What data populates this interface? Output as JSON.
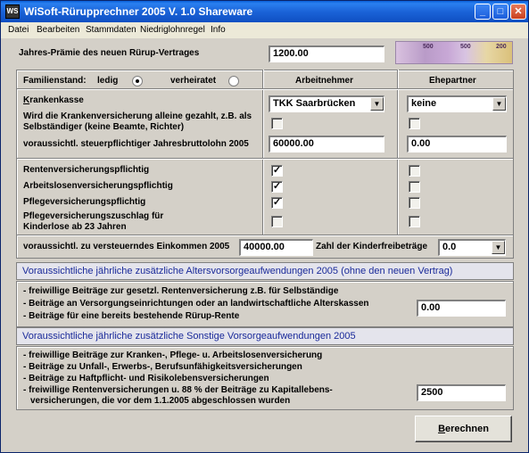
{
  "window": {
    "title": "WiSoft-Rürupprechner 2005 V. 1.0 Shareware",
    "app_icon": "WS"
  },
  "menu": [
    "Datei",
    "Bearbeiten",
    "Stammdaten",
    "Niedriglohnregel",
    "Info"
  ],
  "praemie": {
    "label": "Jahres-Prämie des neuen Rürup-Vertrages",
    "value": "1200.00"
  },
  "banknotes": [
    "500",
    "500",
    "200"
  ],
  "familienstand": {
    "label": "Familienstand:",
    "ledig": "ledig",
    "verheiratet": "verheiratet",
    "selected": "ledig"
  },
  "columns": {
    "arbeitnehmer": "Arbeitnehmer",
    "ehepartner": "Ehepartner"
  },
  "krankenkasse": {
    "label": "Krankenkasse",
    "arbeitnehmer": "TKK Saarbrücken",
    "ehepartner": "keine"
  },
  "alleine": {
    "label": "Wird die Krankenversicherung alleine gezahlt, z.B. als Selbständiger (keine Beamte, Richter)"
  },
  "brutto": {
    "label": "voraussichtl. steuerpflichtiger Jahresbruttolohn 2005",
    "arbeitnehmer": "60000.00",
    "ehepartner": "0.00"
  },
  "pflichten": [
    {
      "label": "Rentenversicherungspflichtig",
      "arbeitnehmer": true,
      "ehepartner": false
    },
    {
      "label": "Arbeitslosenversicherungspflichtig",
      "arbeitnehmer": true,
      "ehepartner": false
    },
    {
      "label": "Pflegeversicherungspflichtig",
      "arbeitnehmer": true,
      "ehepartner": false
    },
    {
      "label": "Pflegeversicherungszuschlag für Kinderlose ab 23 Jahren",
      "arbeitnehmer": false,
      "ehepartner": false
    }
  ],
  "einkommen": {
    "label": "voraussichtl. zu versteuerndes Einkommen 2005",
    "value": "40000.00"
  },
  "kinder": {
    "label": "Zahl der Kinderfreibeträge",
    "value": "0.0"
  },
  "alters": {
    "heading": "Voraussichtliche jährliche zusätzliche Altersvorsorgeaufwendungen 2005 (ohne den neuen Vertrag)",
    "lines": [
      "- freiwillige Beiträge zur gesetzl. Rentenversicherung z.B. für Selbständige",
      "- Beiträge an Versorgungseinrichtungen oder an landwirtschaftliche Alterskassen",
      "- Beiträge für eine bereits bestehende Rürup-Rente"
    ],
    "value": "0.00"
  },
  "sonstige": {
    "heading": "Voraussichtliche jährliche zusätzliche Sonstige Vorsorgeaufwendungen 2005",
    "lines": [
      "- freiwillige Beiträge zur Kranken-, Pflege- u. Arbeitslosenversicherung",
      "- Beiträge zu Unfall-, Erwerbs-, Berufsunfähigkeitsversicherungen",
      "- Beiträge zu Haftpflicht- und Risikolebensversicherungen",
      "- freiwillige Rentenversicherungen u. 88 % der Beiträge zu Kapitallebens-",
      "versicherungen, die vor dem 1.1.2005 abgeschlossen wurden"
    ],
    "value": "2500"
  },
  "berechnen": "Berechnen"
}
